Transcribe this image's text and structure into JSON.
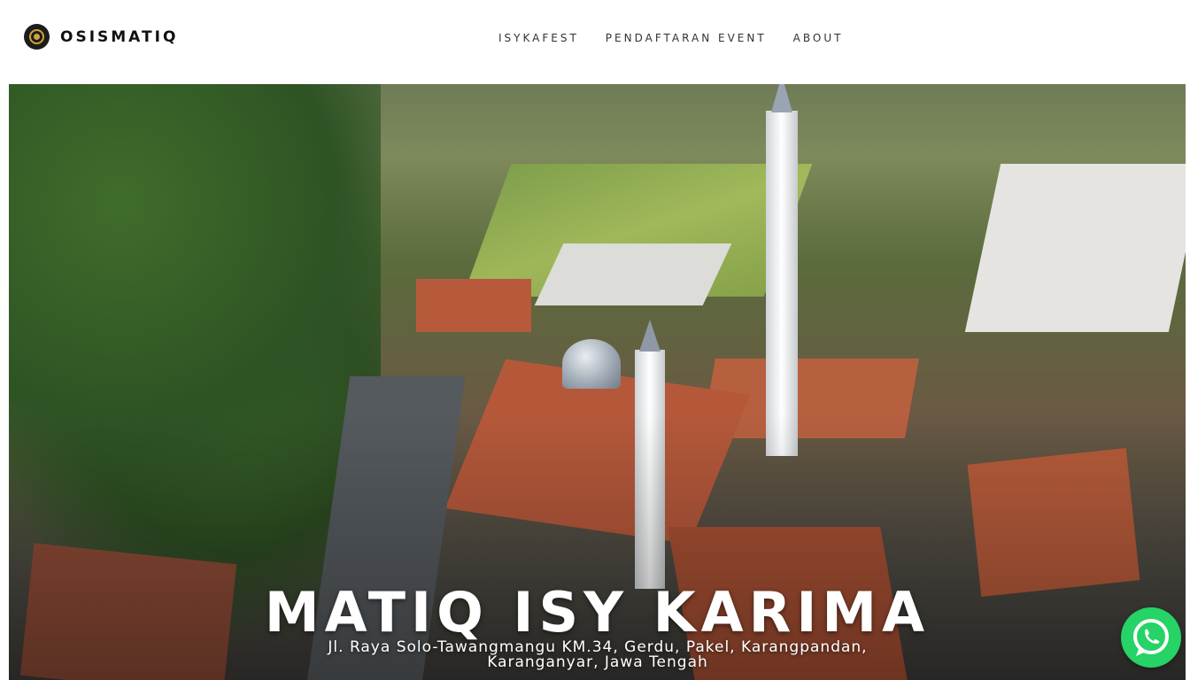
{
  "brand": {
    "name": "OSISMATIQ"
  },
  "nav": {
    "items": [
      "ISYKAFEST",
      "PENDAFTARAN EVENT",
      "ABOUT"
    ]
  },
  "hero": {
    "title": "MATIQ ISY KARIMA",
    "address": "Jl. Raya Solo-Tawangmangu KM.34, Gerdu, Pakel, Karangpandan, Karanganyar, Jawa Tengah"
  },
  "widgets": {
    "chat_icon": "whatsapp-icon",
    "chat_color": "#25d366"
  }
}
